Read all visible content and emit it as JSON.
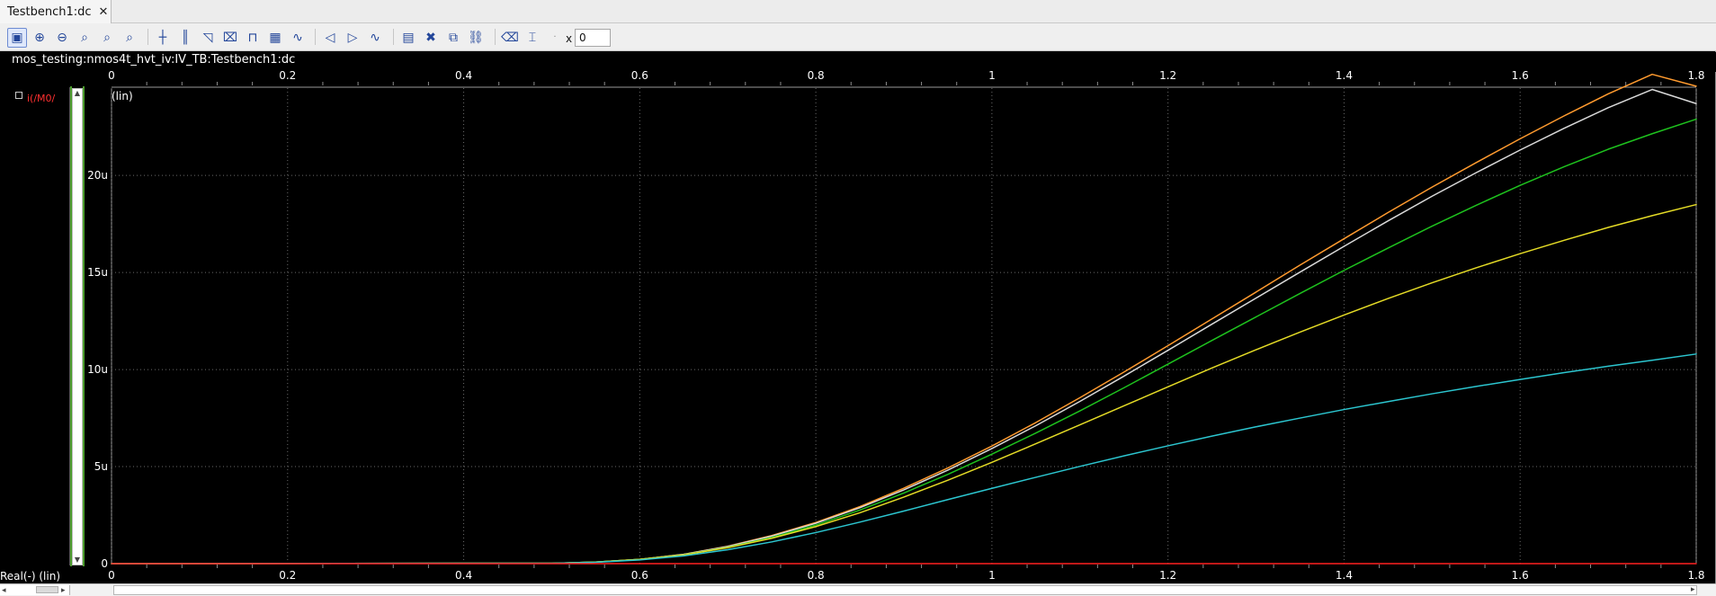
{
  "tabs": [
    {
      "label": "Testbench1:dc"
    }
  ],
  "toolbar": {
    "x_label": "x",
    "x_value": "0"
  },
  "main": {
    "trace_title": "mos_testing:nmos4t_hvt_iv:IV_TB:Testbench1:dc",
    "signal_label": "i(/M0/",
    "yaxis_label": "(lin)",
    "bottom_axis_label": "Real(-) (lin)"
  },
  "colors": {
    "background": "#000000",
    "grid": "#6a6a6a",
    "orange": "#ff9b2f",
    "white": "#d9d9d9",
    "green": "#1ec21e",
    "yellow": "#e4db26",
    "cyan": "#2cc6d0",
    "red": "#ff2020"
  },
  "chart_data": {
    "type": "line",
    "title": "",
    "xlabel": "Real(-) (lin)",
    "ylabel": "(lin)",
    "xlim": [
      0,
      1.8
    ],
    "ylim": [
      0,
      24.5
    ],
    "x_ticks": [
      "0",
      "0.2",
      "0.4",
      "0.6",
      "0.8",
      "1",
      "1.2",
      "1.4",
      "1.6",
      "1.8"
    ],
    "y_ticks": [
      "0",
      "5u",
      "10u",
      "15u",
      "20u"
    ],
    "grid": true,
    "series": [
      {
        "color": "#ff9b2f",
        "x": [
          0,
          0.5,
          0.55,
          0.6,
          0.65,
          0.7,
          0.75,
          0.8,
          0.85,
          0.9,
          0.95,
          1.0,
          1.05,
          1.1,
          1.15,
          1.2,
          1.25,
          1.3,
          1.35,
          1.4,
          1.45,
          1.5,
          1.55,
          1.6,
          1.65,
          1.7,
          1.75,
          1.8
        ],
        "y": [
          0,
          0.02,
          0.08,
          0.22,
          0.48,
          0.9,
          1.45,
          2.12,
          2.94,
          3.89,
          4.93,
          6.06,
          7.27,
          8.55,
          9.87,
          11.23,
          12.61,
          13.99,
          15.38,
          16.74,
          18.09,
          19.4,
          20.66,
          21.89,
          23.07,
          24.2,
          25.21,
          24.6
        ]
      },
      {
        "color": "#d9d9d9",
        "x": [
          0,
          0.5,
          0.55,
          0.6,
          0.65,
          0.7,
          0.75,
          0.8,
          0.85,
          0.9,
          0.95,
          1.0,
          1.05,
          1.1,
          1.15,
          1.2,
          1.25,
          1.3,
          1.35,
          1.4,
          1.45,
          1.5,
          1.55,
          1.6,
          1.65,
          1.7,
          1.75,
          1.8
        ],
        "y": [
          0,
          0.02,
          0.08,
          0.22,
          0.48,
          0.88,
          1.42,
          2.08,
          2.88,
          3.8,
          4.82,
          5.93,
          7.11,
          8.36,
          9.66,
          10.99,
          12.34,
          13.68,
          15.02,
          16.35,
          17.66,
          18.93,
          20.14,
          21.31,
          22.43,
          23.49,
          24.43,
          23.7
        ]
      },
      {
        "color": "#1ec21e",
        "x": [
          0,
          0.5,
          0.55,
          0.6,
          0.65,
          0.7,
          0.75,
          0.8,
          0.85,
          0.9,
          0.95,
          1.0,
          1.05,
          1.1,
          1.15,
          1.2,
          1.25,
          1.3,
          1.35,
          1.4,
          1.45,
          1.5,
          1.55,
          1.6,
          1.65,
          1.7,
          1.75,
          1.8
        ],
        "y": [
          0,
          0.02,
          0.08,
          0.22,
          0.46,
          0.84,
          1.35,
          1.99,
          2.76,
          3.64,
          4.6,
          5.64,
          6.73,
          7.87,
          9.06,
          10.28,
          11.5,
          12.71,
          13.92,
          15.11,
          16.26,
          17.39,
          18.46,
          19.49,
          20.45,
          21.35,
          22.15,
          22.9
        ]
      },
      {
        "color": "#e4db26",
        "x": [
          0,
          0.5,
          0.55,
          0.6,
          0.65,
          0.7,
          0.75,
          0.8,
          0.85,
          0.9,
          0.95,
          1.0,
          1.05,
          1.1,
          1.15,
          1.2,
          1.25,
          1.3,
          1.35,
          1.4,
          1.45,
          1.5,
          1.55,
          1.6,
          1.65,
          1.7,
          1.75,
          1.8
        ],
        "y": [
          0,
          0.02,
          0.08,
          0.22,
          0.45,
          0.82,
          1.31,
          1.91,
          2.62,
          3.43,
          4.3,
          5.22,
          6.18,
          7.15,
          8.13,
          9.11,
          10.08,
          11.02,
          11.93,
          12.81,
          13.66,
          14.47,
          15.24,
          15.97,
          16.66,
          17.32,
          17.93,
          18.5
        ]
      },
      {
        "color": "#2cc6d0",
        "x": [
          0,
          0.5,
          0.55,
          0.6,
          0.65,
          0.7,
          0.75,
          0.8,
          0.85,
          0.9,
          0.95,
          1.0,
          1.05,
          1.1,
          1.15,
          1.2,
          1.25,
          1.3,
          1.35,
          1.4,
          1.45,
          1.5,
          1.55,
          1.6,
          1.65,
          1.7,
          1.75,
          1.8
        ],
        "y": [
          0,
          0.02,
          0.07,
          0.19,
          0.4,
          0.72,
          1.12,
          1.6,
          2.14,
          2.71,
          3.3,
          3.88,
          4.45,
          5.01,
          5.55,
          6.07,
          6.57,
          7.05,
          7.5,
          7.94,
          8.35,
          8.75,
          9.13,
          9.49,
          9.84,
          10.17,
          10.48,
          10.8
        ]
      },
      {
        "color": "#ff2020",
        "x": [
          0,
          1.8
        ],
        "y": [
          0,
          0
        ]
      }
    ]
  }
}
